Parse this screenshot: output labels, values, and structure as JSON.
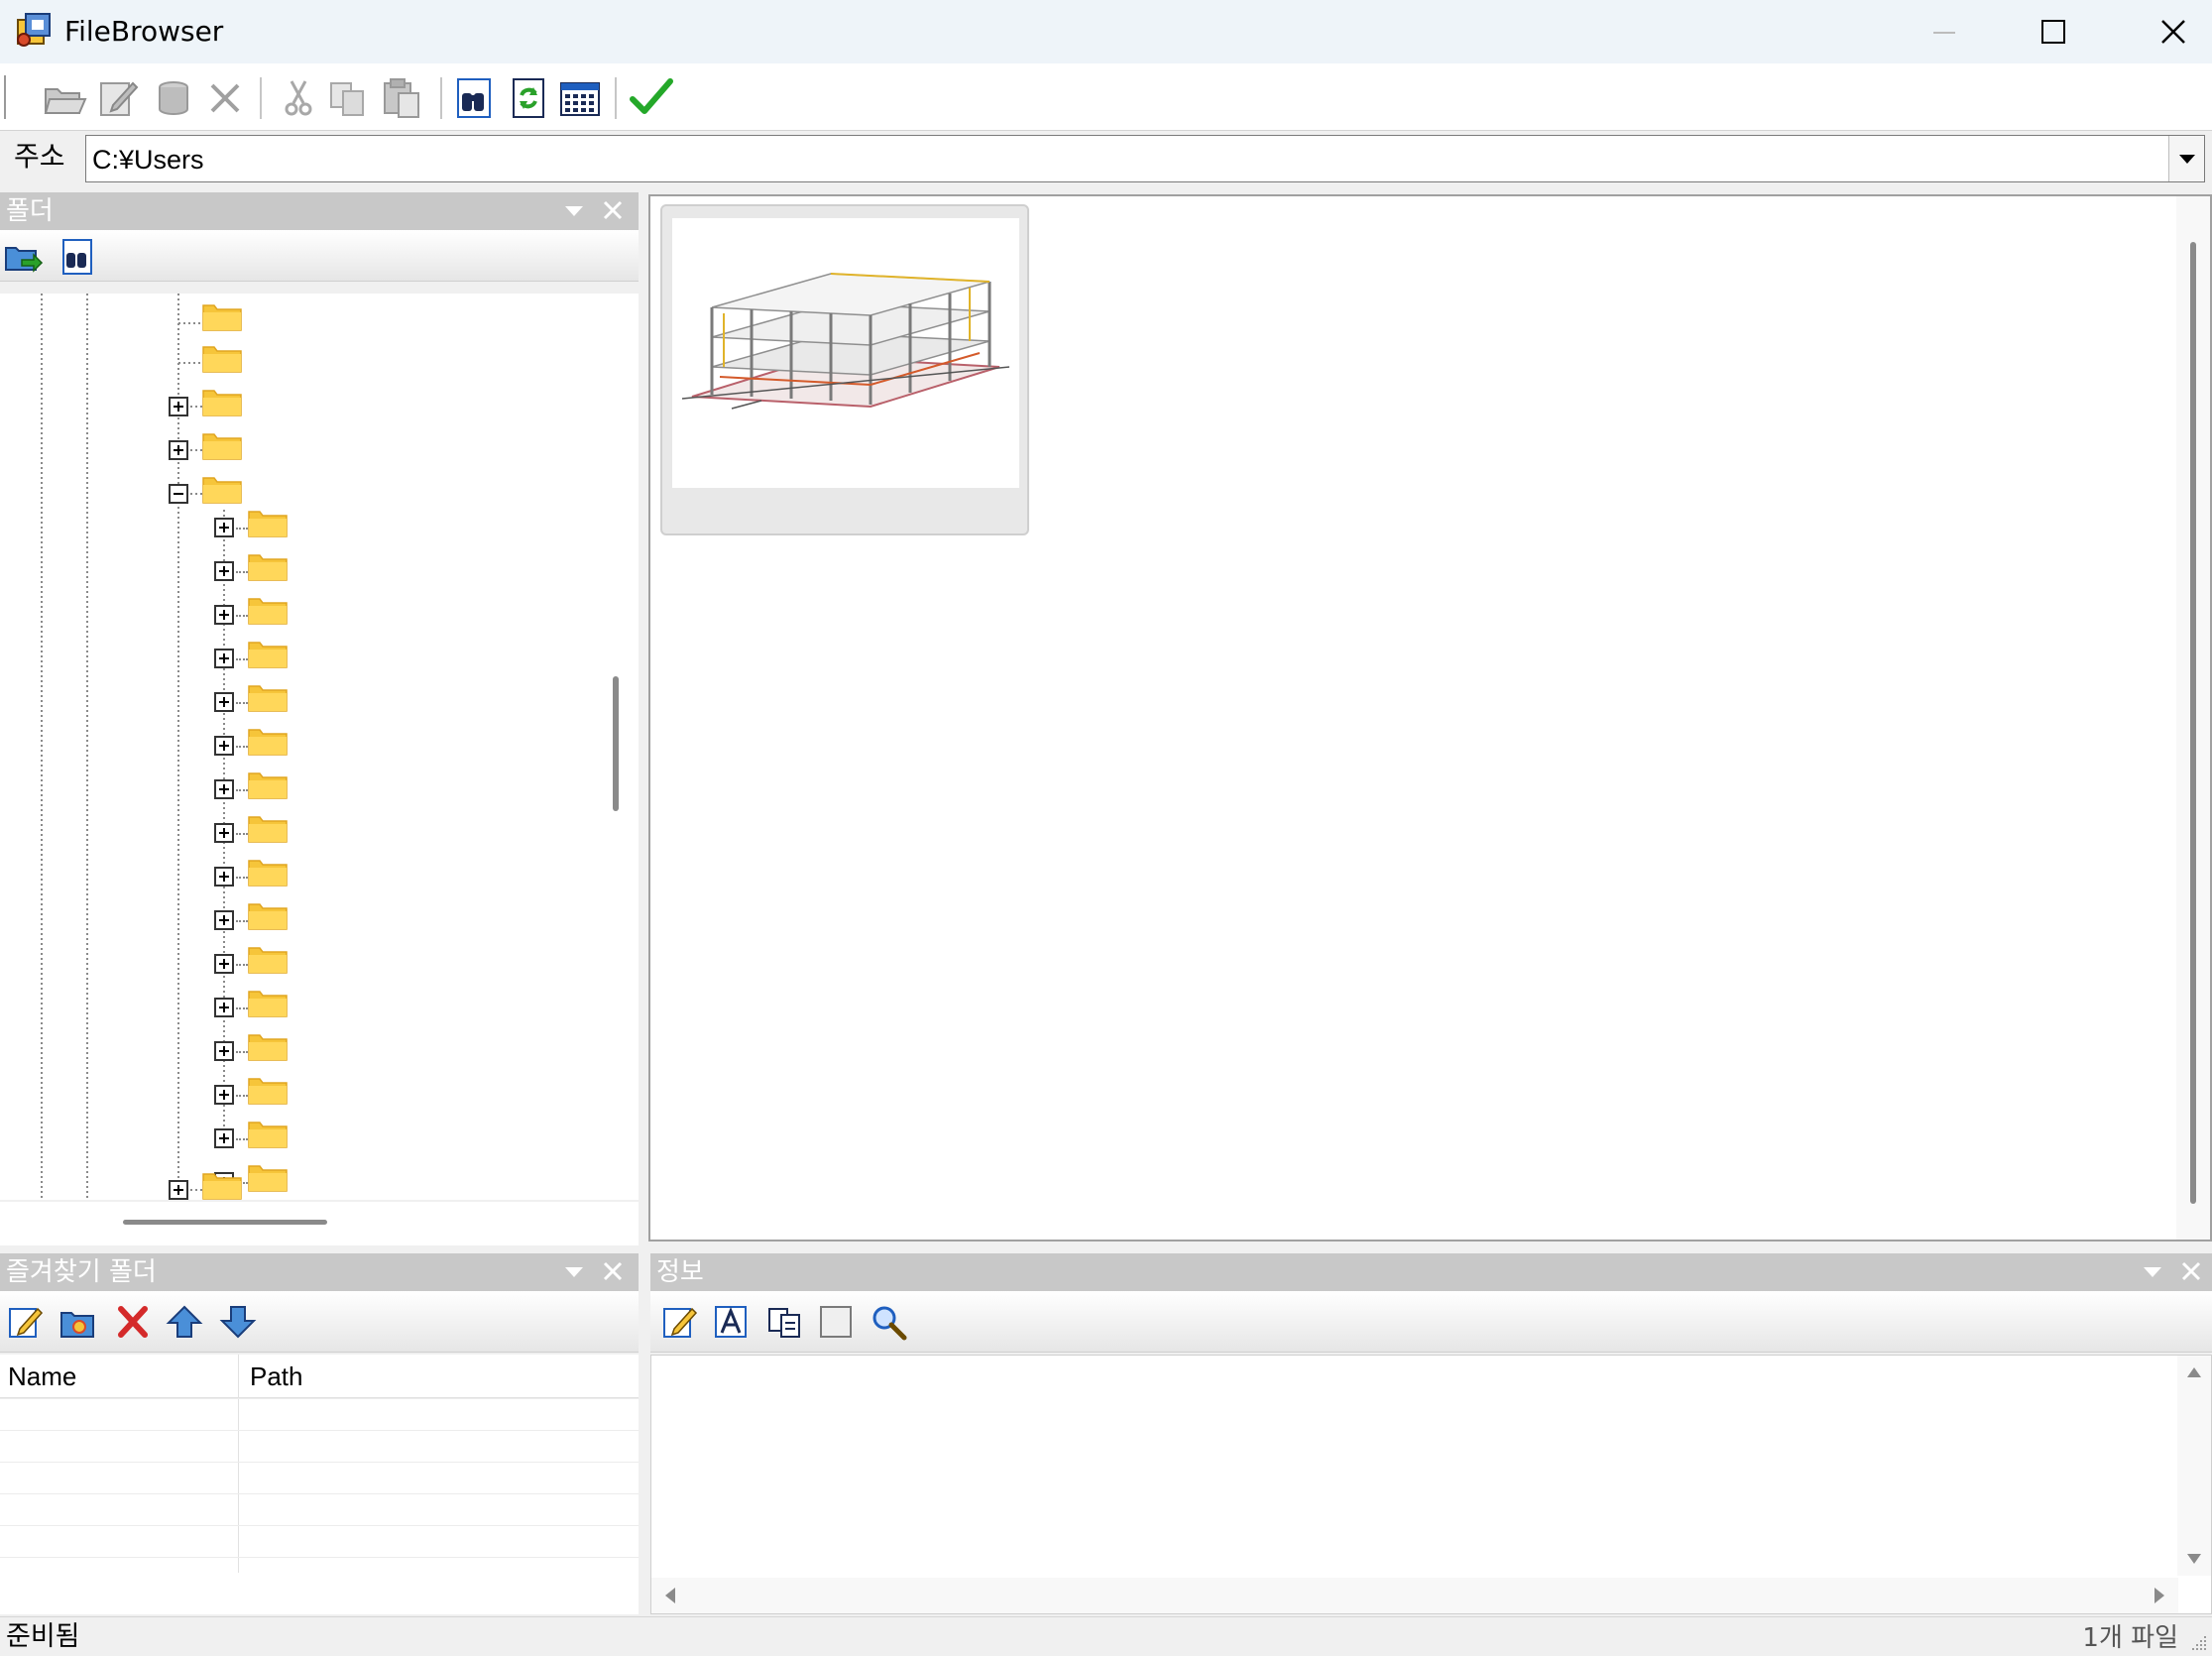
{
  "window": {
    "title": "FileBrowser",
    "icon": "filebrowser-app-icon",
    "controls": [
      "minimize",
      "maximize",
      "close"
    ]
  },
  "toolbar": {
    "buttons": [
      {
        "name": "open-folder",
        "icon": "open-folder-icon",
        "enabled": false
      },
      {
        "name": "edit",
        "icon": "edit-icon",
        "enabled": false
      },
      {
        "name": "database",
        "icon": "database-icon",
        "enabled": false
      },
      {
        "name": "delete",
        "icon": "delete-x-icon",
        "enabled": false
      },
      {
        "name": "cut",
        "icon": "scissors-icon",
        "enabled": false
      },
      {
        "name": "copy",
        "icon": "copy-icon",
        "enabled": false
      },
      {
        "name": "paste",
        "icon": "paste-icon",
        "enabled": false
      },
      {
        "name": "find",
        "icon": "binoculars-icon",
        "enabled": true
      },
      {
        "name": "refresh",
        "icon": "refresh-icon",
        "enabled": true
      },
      {
        "name": "view-details",
        "icon": "table-view-icon",
        "enabled": true
      },
      {
        "name": "ok",
        "icon": "checkmark-icon",
        "enabled": true
      }
    ]
  },
  "address": {
    "label": "주소",
    "value": "C:¥Users"
  },
  "folders_pane": {
    "title": "폴더",
    "tools": [
      "go-to-folder-icon",
      "find-folder-icon"
    ]
  },
  "favorites_pane": {
    "title": "즐겨찾기 폴더",
    "tools": [
      "edit-favorite-icon",
      "add-favorite-icon",
      "remove-favorite-icon",
      "move-up-icon",
      "move-down-icon"
    ],
    "columns": {
      "name": "Name",
      "path": "Path"
    }
  },
  "info_pane": {
    "title": "정보",
    "tools": [
      "edit-info-icon",
      "text-icon",
      "copy-info-icon",
      "blank-icon",
      "zoom-icon"
    ]
  },
  "status": {
    "left": "준비됨",
    "right": "1개 파일"
  },
  "colors": {
    "folder": "#f6c53a",
    "folder_dark": "#e0a521",
    "pane_header": "#c8c8c8",
    "accent_blue": "#1f5fbf"
  }
}
